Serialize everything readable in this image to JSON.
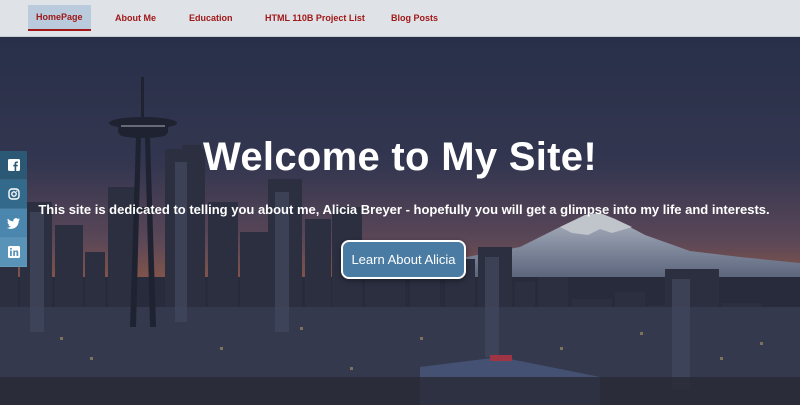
{
  "nav": {
    "items": [
      {
        "label": "HomePage",
        "active": true
      },
      {
        "label": "About Me"
      },
      {
        "label": "Education"
      },
      {
        "label": "HTML 110B Project List"
      },
      {
        "label": "Blog Posts"
      }
    ],
    "accent_color": "#a01818",
    "active_bg": "#b9cbdd"
  },
  "hero": {
    "title": "Welcome to My Site!",
    "tagline": "This site is dedicated to telling you about me, Alicia Breyer - hopefully you will get a glimpse into my life and interests.",
    "cta_label": "Learn About Alicia",
    "cta_color": "#4a7ba2",
    "background": "seattle-skyline-at-dusk"
  },
  "social": {
    "icons": [
      "facebook-icon",
      "instagram-icon",
      "twitter-icon",
      "linkedin-icon"
    ]
  }
}
